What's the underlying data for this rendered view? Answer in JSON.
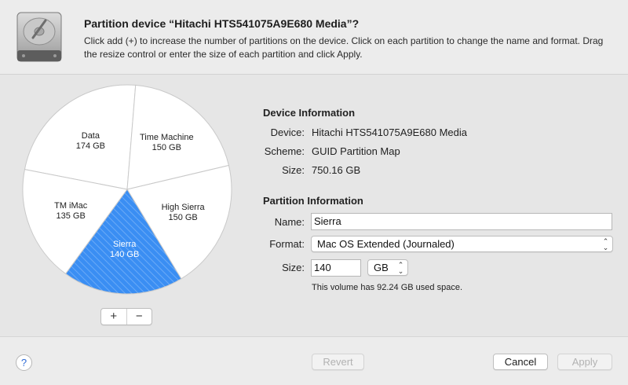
{
  "dialog": {
    "title": "Partition device “Hitachi HTS541075A9E680 Media”?",
    "description": "Click add (+) to increase the number of partitions on the device. Click on each partition to change the name and format. Drag the resize control or enter the size of each partition and click Apply."
  },
  "pie": {
    "partitions": [
      {
        "name": "Data",
        "size": "174 GB",
        "value": 174,
        "selected": false
      },
      {
        "name": "Time Machine",
        "size": "150 GB",
        "value": 150,
        "selected": false
      },
      {
        "name": "High Sierra",
        "size": "150 GB",
        "value": 150,
        "selected": false
      },
      {
        "name": "Sierra",
        "size": "140 GB",
        "value": 140,
        "selected": true
      },
      {
        "name": "TM iMac",
        "size": "135 GB",
        "value": 135,
        "selected": false
      }
    ],
    "selected_color": "#3a8ef3",
    "add_label": "+",
    "remove_label": "−"
  },
  "device_info": {
    "heading": "Device Information",
    "device_label": "Device:",
    "device_value": "Hitachi HTS541075A9E680 Media",
    "scheme_label": "Scheme:",
    "scheme_value": "GUID Partition Map",
    "size_label": "Size:",
    "size_value": "750.16 GB"
  },
  "partition_info": {
    "heading": "Partition Information",
    "name_label": "Name:",
    "name_value": "Sierra",
    "format_label": "Format:",
    "format_value": "Mac OS Extended (Journaled)",
    "size_label": "Size:",
    "size_value": "140",
    "unit_value": "GB",
    "note": "This volume has 92.24 GB used space."
  },
  "footer": {
    "help_label": "?",
    "revert_label": "Revert",
    "cancel_label": "Cancel",
    "apply_label": "Apply"
  },
  "icons": {
    "disk": "hard-disk-icon",
    "popup": "updown-chevron-icon",
    "help": "help-icon"
  }
}
